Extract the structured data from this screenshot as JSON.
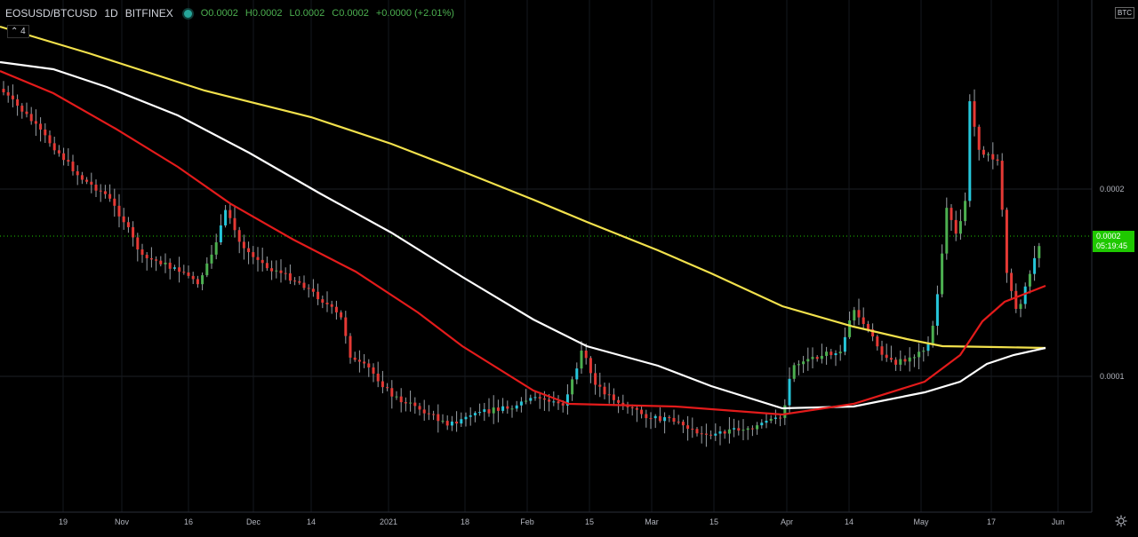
{
  "header": {
    "symbol": "EOSUSD/BTCUSD",
    "interval": "1D",
    "exchange": "BITFINEX",
    "open": "O0.0002",
    "high": "H0.0002",
    "low": "L0.0002",
    "close": "C0.0002",
    "change": "+0.0000 (+2.01%)"
  },
  "indicator_chip": "4",
  "currency_badge": "BTC",
  "price_label": {
    "price": "0.0002",
    "countdown": "05:19:45"
  },
  "colors": {
    "up": "#4caf50",
    "up_alt": "#26c6da",
    "down": "#e53935",
    "ma_yellow": "#f2e14c",
    "ma_white": "#ffffff",
    "ma_red": "#e31b1b",
    "price_label_bg": "#1fc800"
  },
  "chart_data": {
    "type": "candlestick",
    "x_axis": {
      "tick_labels": [
        "19",
        "Nov",
        "16",
        "Dec",
        "14",
        "2021",
        "18",
        "Feb",
        "15",
        "Mar",
        "15",
        "Apr",
        "14",
        "May",
        "17",
        "Jun"
      ]
    },
    "y_axis": {
      "tick_labels": [
        "0.0002",
        "0.0001"
      ],
      "current_price": "0.0002"
    },
    "moving_averages": [
      {
        "color": "yellow"
      },
      {
        "color": "white"
      },
      {
        "color": "red"
      }
    ],
    "grid": true
  }
}
